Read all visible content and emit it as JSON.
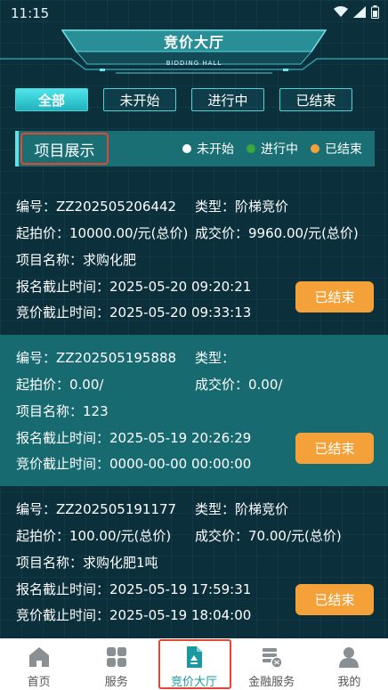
{
  "status": {
    "time": "11:15"
  },
  "header": {
    "title": "竞价大厅",
    "subtitle": "BIDDING HALL"
  },
  "tabs": [
    {
      "label": "全部",
      "active": true
    },
    {
      "label": "未开始",
      "active": false
    },
    {
      "label": "进行中",
      "active": false
    },
    {
      "label": "已结束",
      "active": false
    }
  ],
  "section": {
    "title": "项目展示",
    "legend": [
      {
        "label": "未开始",
        "color": "#ffffff"
      },
      {
        "label": "进行中",
        "color": "#3aa83a"
      },
      {
        "label": "已结束",
        "color": "#f5a13a"
      }
    ]
  },
  "cards": [
    {
      "code": "编号：ZZ202505206442",
      "type": "类型：阶梯竞价",
      "start_price": "起拍价：10000.00/元(总价)",
      "deal_price": "成交价：9960.00/元(总价)",
      "name": "项目名称：求购化肥",
      "signup_deadline": "报名截止时间：2025-05-20 09:20:21",
      "bid_deadline": "竞价截止时间：2025-05-20 09:33:13",
      "status": "已结束"
    },
    {
      "code": "编号：ZZ202505195888",
      "type": "类型：",
      "start_price": "起拍价：0.00/",
      "deal_price": "成交价：0.00/",
      "name": "项目名称：123",
      "signup_deadline": "报名截止时间：2025-05-19 20:26:29",
      "bid_deadline": "竞价截止时间：0000-00-00 00:00:00",
      "status": "已结束"
    },
    {
      "code": "编号：ZZ202505191177",
      "type": "类型：阶梯竞价",
      "start_price": "起拍价：100.00/元(总价)",
      "deal_price": "成交价：70.00/元(总价)",
      "name": "项目名称：求购化肥1吨",
      "signup_deadline": "报名截止时间：2025-05-19 17:59:31",
      "bid_deadline": "竞价截止时间：2025-05-19 18:04:00",
      "status": "已结束"
    }
  ],
  "nav": [
    {
      "label": "首页",
      "icon": "home-icon"
    },
    {
      "label": "服务",
      "icon": "grid-icon"
    },
    {
      "label": "竞价大厅",
      "icon": "bidding-icon",
      "active": true
    },
    {
      "label": "金融服务",
      "icon": "finance-icon"
    },
    {
      "label": "我的",
      "icon": "user-icon"
    }
  ]
}
